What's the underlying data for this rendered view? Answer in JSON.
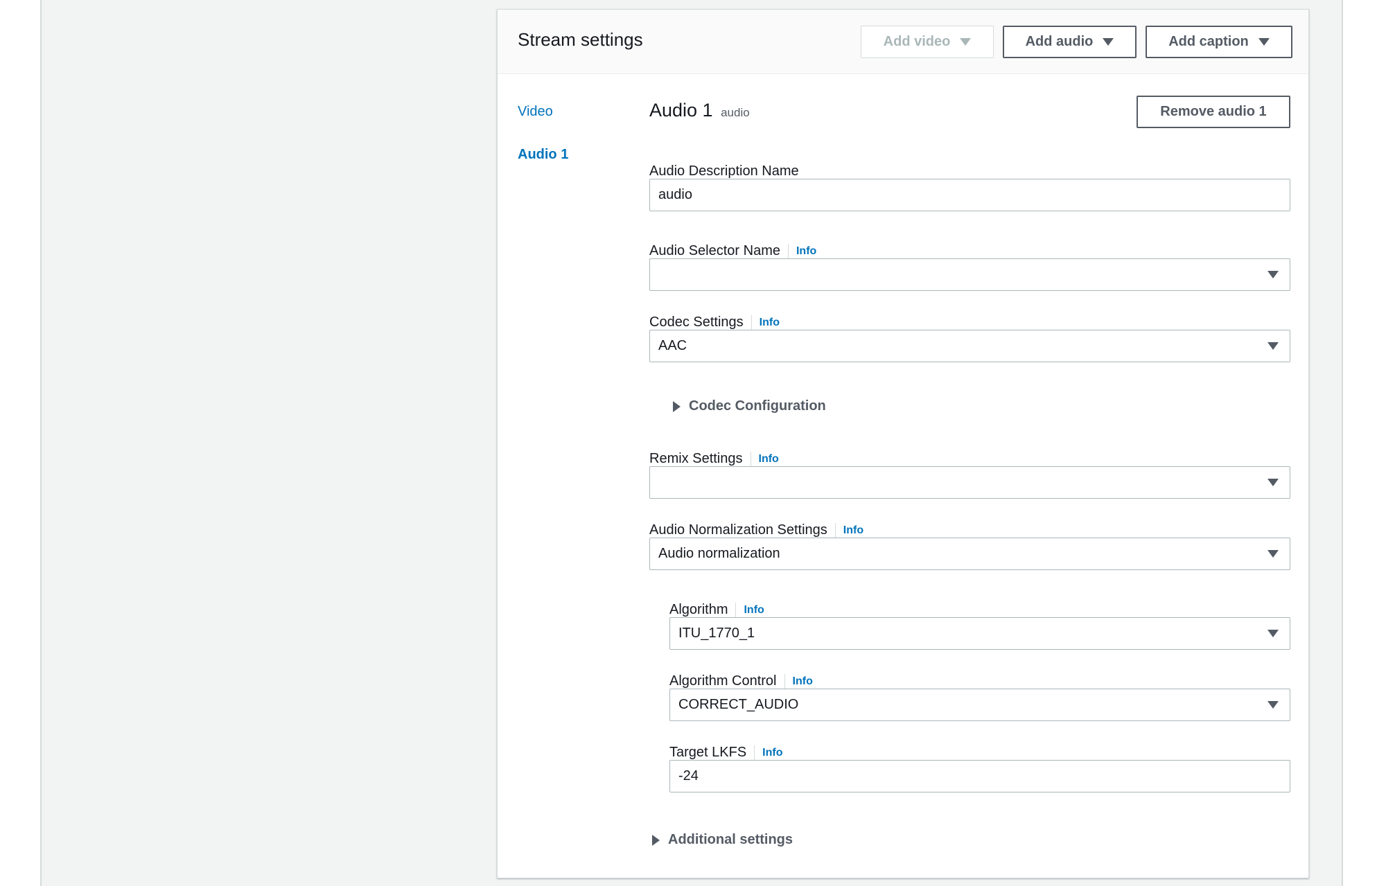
{
  "panel": {
    "title": "Stream settings",
    "buttons": {
      "add_video": "Add video",
      "add_audio": "Add audio",
      "add_caption": "Add caption"
    }
  },
  "sidebar": {
    "items": [
      {
        "label": "Video",
        "active": false
      },
      {
        "label": "Audio 1",
        "active": true
      }
    ]
  },
  "audio": {
    "title": "Audio 1",
    "subtitle": "audio",
    "remove_label": "Remove audio 1",
    "info_label": "Info",
    "fields": {
      "description_name": {
        "label": "Audio Description Name",
        "value": "audio"
      },
      "selector_name": {
        "label": "Audio Selector Name",
        "value": ""
      },
      "codec_settings": {
        "label": "Codec Settings",
        "value": "AAC"
      },
      "codec_configuration": {
        "label": "Codec Configuration"
      },
      "remix_settings": {
        "label": "Remix Settings",
        "value": ""
      },
      "normalization_settings": {
        "label": "Audio Normalization Settings",
        "value": "Audio normalization"
      },
      "algorithm": {
        "label": "Algorithm",
        "value": "ITU_1770_1"
      },
      "algorithm_control": {
        "label": "Algorithm Control",
        "value": "CORRECT_AUDIO"
      },
      "target_lkfs": {
        "label": "Target LKFS",
        "value": "-24"
      },
      "additional_settings": {
        "label": "Additional settings"
      }
    }
  },
  "colors": {
    "link": "#0073bb",
    "text": "#16191f",
    "button_border": "#545b64",
    "page_background": "#f2f3f3"
  }
}
